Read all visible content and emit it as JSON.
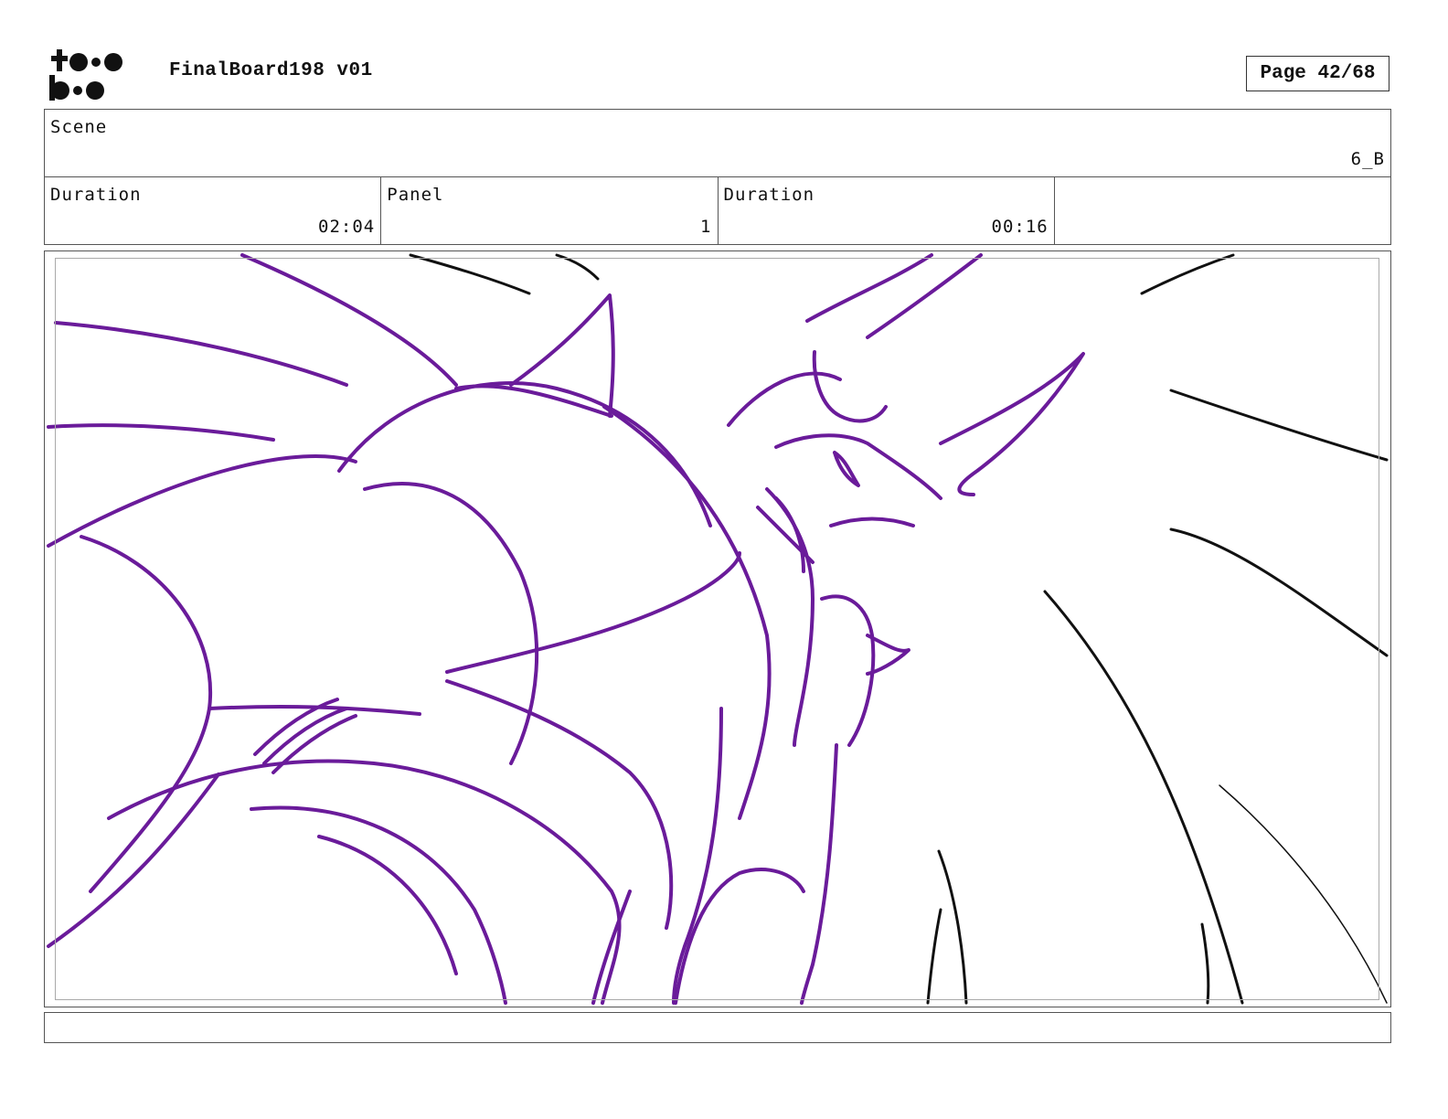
{
  "header": {
    "logo_text": "toon boom",
    "project_title": "FinalBoard198 v01",
    "page_label": "Page 42/68"
  },
  "scene": {
    "label": "Scene",
    "value": "6_B"
  },
  "info": [
    {
      "label": "Duration",
      "value": "02:04"
    },
    {
      "label": "Panel",
      "value": "1"
    },
    {
      "label": "Duration",
      "value": "00:16"
    },
    {
      "label": "",
      "value": ""
    }
  ],
  "colors": {
    "sketch_primary": "#6a1b9a",
    "sketch_secondary": "#111111"
  }
}
